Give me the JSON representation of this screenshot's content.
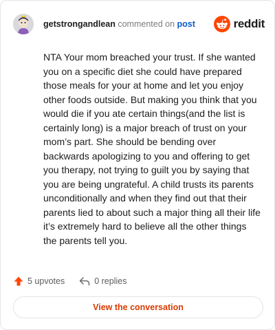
{
  "header": {
    "username": "getstrongandlean",
    "action_text": "commented on",
    "post_link": "post",
    "brand_name": "reddit",
    "brand_color": "#ff4500"
  },
  "comment": {
    "body": "NTA Your mom breached your trust. If she wanted you on a specific diet she could have prepared those meals for your at home and let you enjoy other foods outside. But making you think that you would die if you ate certain things(and the list is certainly long) is a major breach of trust on your mom’s part. She should be bending over backwards apologizing to you and offering to get you therapy, not trying to guilt you by saying that you are being ungrateful. A child trusts its parents unconditionally and when they find out that their parents lied to about such a major thing all their life it’s extremely hard to believe all the other things the parents tell you."
  },
  "actions": {
    "upvotes_label": "5 upvotes",
    "replies_label": "0 replies",
    "upvote_icon": "upvote-arrow-icon",
    "reply_icon": "reply-arrow-icon",
    "upvote_color": "#ff4500"
  },
  "cta": {
    "label": "View the conversation",
    "color": "#d93a00"
  }
}
